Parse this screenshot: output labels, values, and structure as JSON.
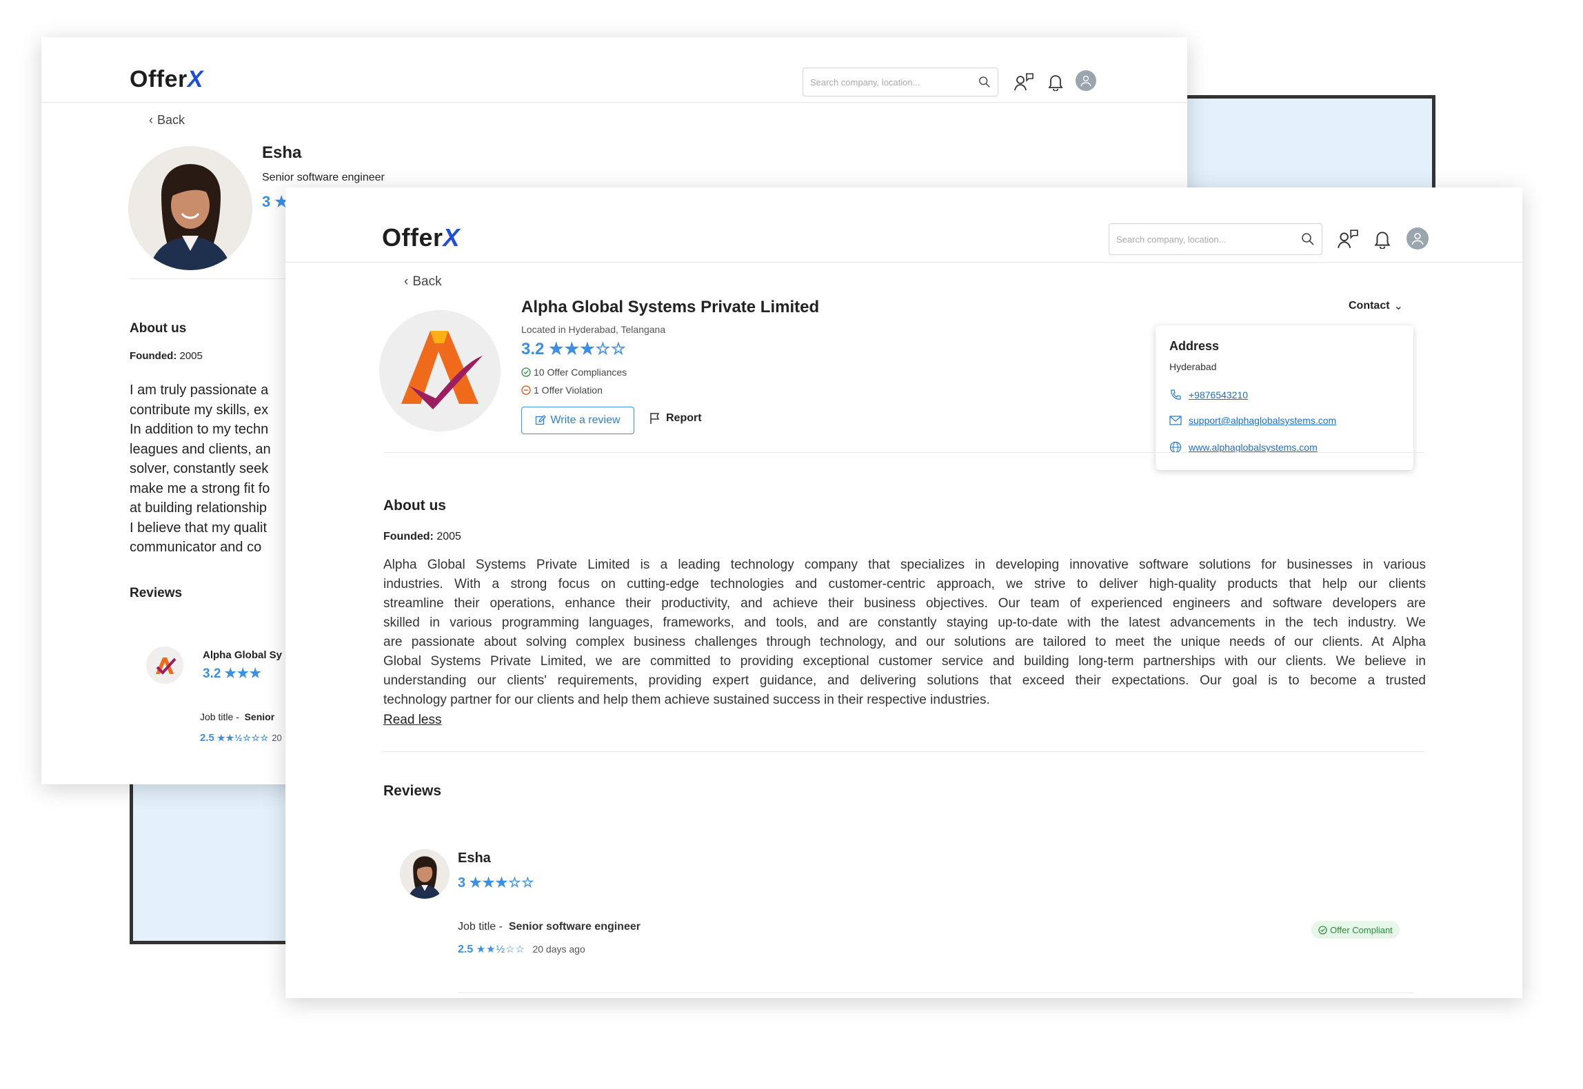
{
  "brand": {
    "name_main": "Offer",
    "name_x": "X"
  },
  "search": {
    "placeholder": "Search company, location..."
  },
  "nav": {
    "back_label": "Back"
  },
  "back_window": {
    "profile": {
      "name": "Esha",
      "job_title": "Senior software engineer",
      "rating": "3"
    },
    "about": {
      "heading": "About us",
      "founded_label": "Founded:",
      "founded_value": "2005",
      "lines": [
        "I am truly passionate a",
        "contribute my skills, ex",
        "In addition to my techn",
        "leagues and clients, an",
        "solver, constantly seek",
        "make me a strong fit fo",
        "at building relationship",
        "I believe that my qualit",
        "communicator and co"
      ]
    },
    "reviews": {
      "heading": "Reviews",
      "company_name": "Alpha Global Sy",
      "company_rating": "3.2",
      "job_title_label": "Job title -",
      "job_title_value": "Senior",
      "rating": "2.5",
      "age_partial": "20"
    }
  },
  "front_window": {
    "company": {
      "name": "Alpha Global Systems Private Limited",
      "location": "Located in Hyderabad, Telangana",
      "rating": "3.2",
      "compliances": "10 Offer Compliances",
      "violations": "1 Offer Violation",
      "write_review_label": "Write a review",
      "report_label": "Report"
    },
    "contact": {
      "toggle_label": "Contact",
      "address_heading": "Address",
      "address_value": "Hyderabad",
      "phone": "+9876543210",
      "email": "support@alphaglobalsystems.com",
      "website": "www.alphaglobalsystems.com"
    },
    "about": {
      "heading": "About us",
      "founded_label": "Founded:",
      "founded_value": "2005",
      "lines": [
        "Alpha Global Systems Private Limited is a leading technology company that specializes in developing innovative software solutions for businesses in various",
        "industries. With a strong focus on cutting-edge technologies and customer-centric approach, we strive to deliver high-quality products that help our clients",
        "streamline their operations, enhance their productivity, and achieve their business objectives. Our team of experienced engineers and software developers are",
        "skilled in various programming languages, frameworks, and tools, and are constantly staying up-to-date with the latest advancements in the tech industry. We",
        "are passionate about solving complex business challenges through technology, and our solutions are tailored to meet the unique needs of our clients. At Alpha",
        "Global Systems Private Limited, we are committed to providing exceptional customer service and building long-term partnerships with our clients. We believe in",
        "understanding our clients' requirements, providing expert guidance, and delivering solutions that exceed their expectations. Our goal is to become a trusted",
        "technology partner for our clients and help them achieve sustained success in their respective industries."
      ],
      "read_less_label": "Read less"
    },
    "reviews": {
      "heading": "Reviews",
      "reviewer_name": "Esha",
      "reviewer_rating": "3",
      "job_title_label": "Job title -",
      "job_title_value": "Senior software engineer",
      "rating": "2.5",
      "age": "20 days ago",
      "badge": "Offer Compliant"
    }
  },
  "colors": {
    "accent": "#3b8fe4",
    "brand_x": "#1e4ed8",
    "badge_bg": "#e6f6e9",
    "badge_text": "#2c8b3c",
    "backdrop": "#e4f1fc"
  }
}
